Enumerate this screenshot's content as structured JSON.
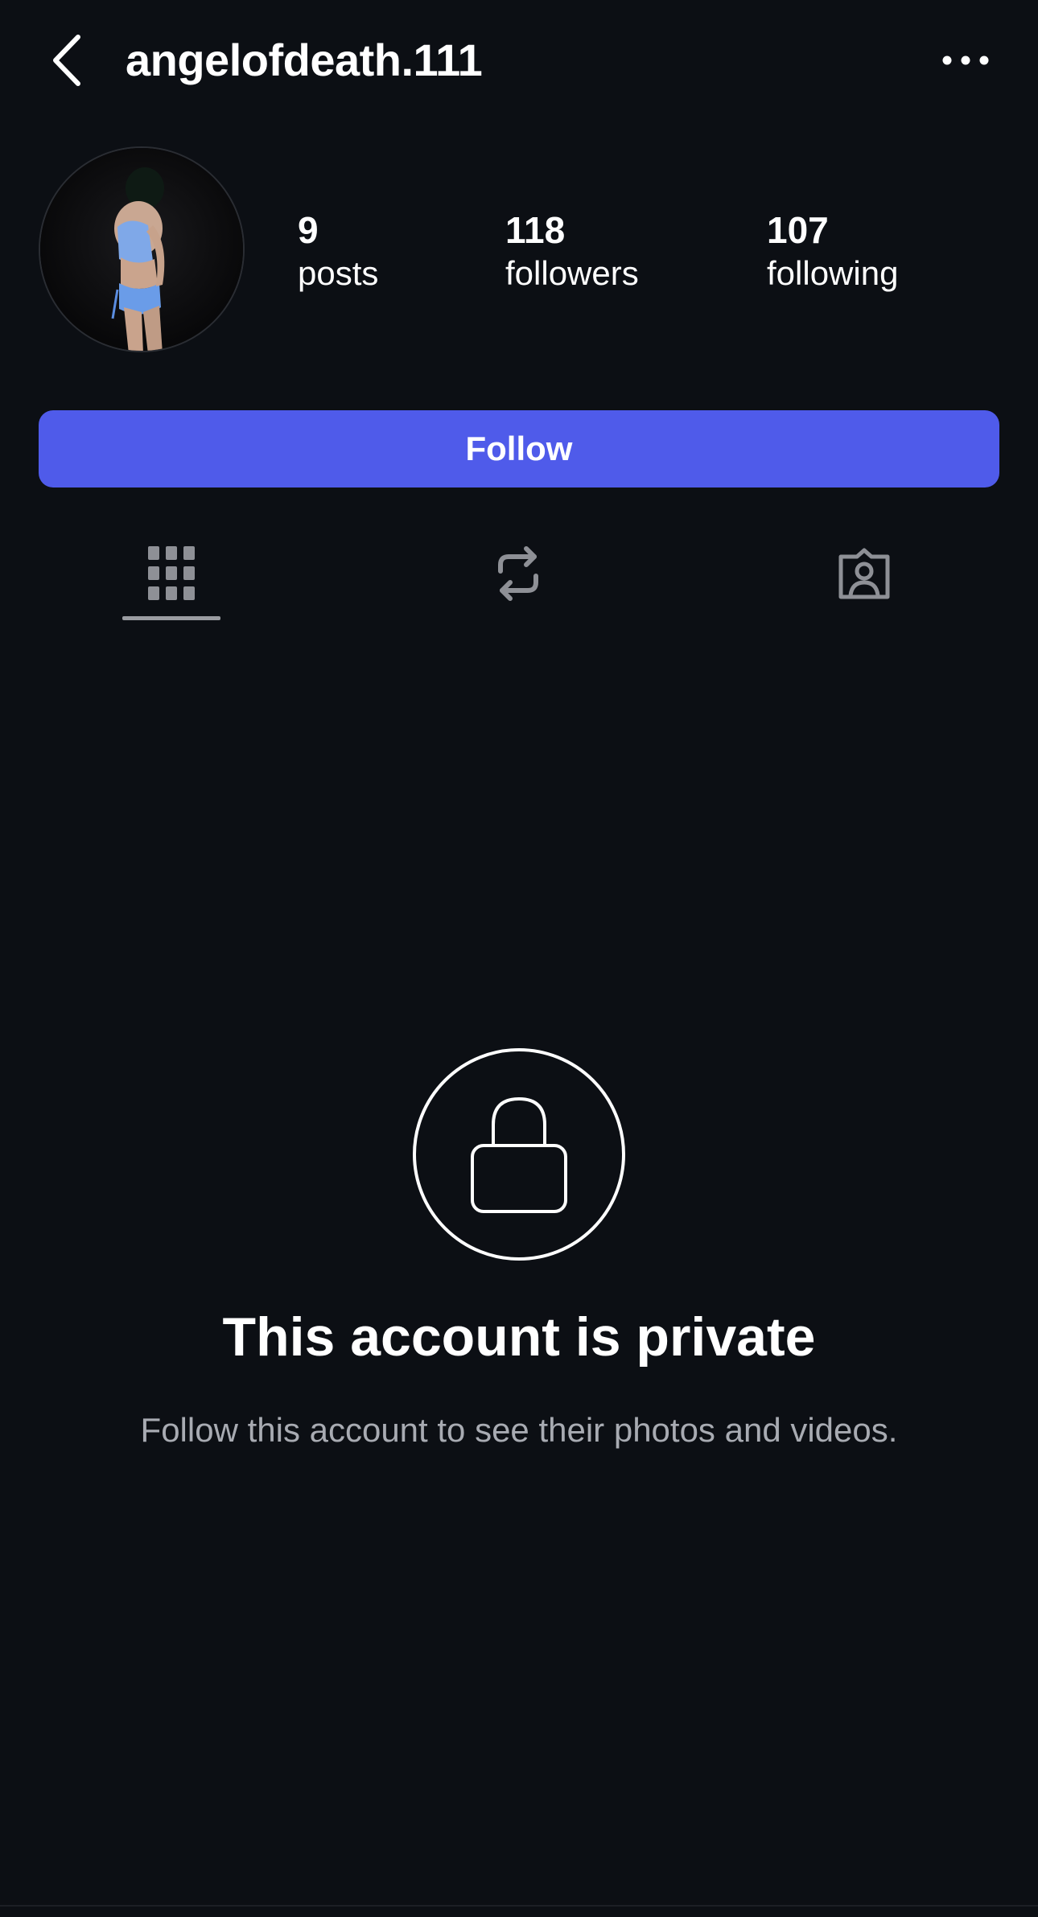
{
  "header": {
    "back_icon": "chevron-left-icon",
    "username": "angelofdeath.111",
    "more_icon": "more-horizontal-icon"
  },
  "profile": {
    "avatar": "profile-photo",
    "stats": {
      "posts": {
        "value": "9",
        "label": "posts"
      },
      "followers": {
        "value": "118",
        "label": "followers"
      },
      "following": {
        "value": "107",
        "label": "following"
      }
    }
  },
  "actions": {
    "follow_label": "Follow"
  },
  "tabs": [
    {
      "icon": "grid-icon",
      "active": true
    },
    {
      "icon": "repost-icon",
      "active": false
    },
    {
      "icon": "tagged-person-icon",
      "active": false
    }
  ],
  "private_notice": {
    "icon": "lock-icon",
    "title": "This account is private",
    "subtitle": "Follow this account to see their photos and videos."
  },
  "colors": {
    "background": "#0c0f14",
    "accent": "#4f5bea",
    "text_primary": "#ffffff",
    "text_secondary": "#a8abb2",
    "icon_inactive": "#8e9096"
  }
}
